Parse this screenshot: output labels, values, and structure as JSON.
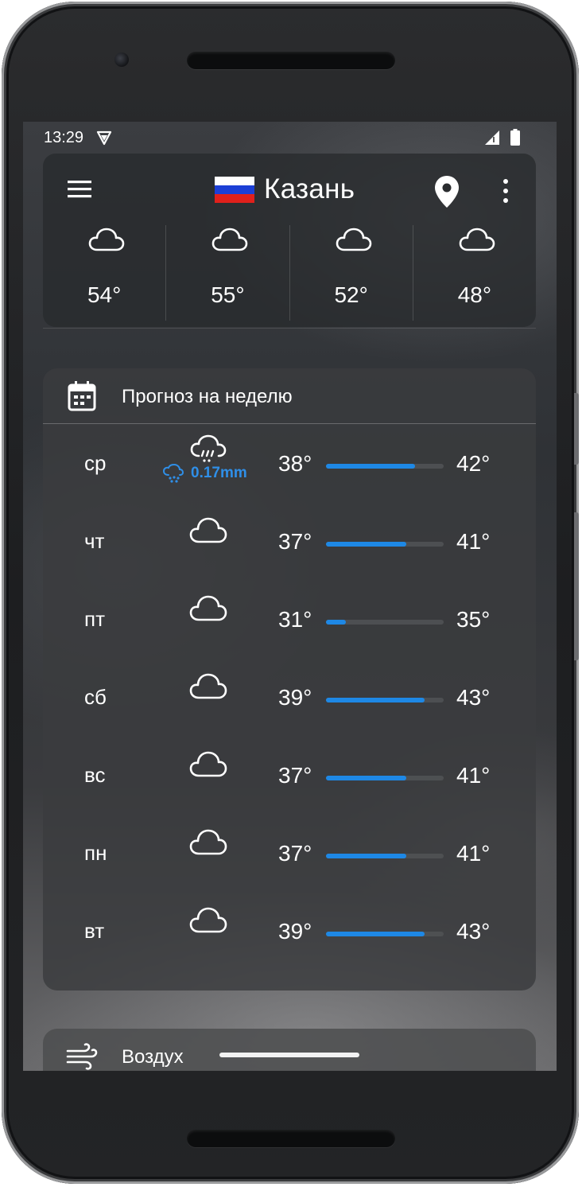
{
  "status_bar": {
    "time": "13:29",
    "icons": [
      "vpn-icon",
      "signal-icon",
      "battery-icon"
    ]
  },
  "header": {
    "city": "Казань",
    "flag": "russia-flag",
    "flag_colors": [
      "#ffffff",
      "#1c3fd6",
      "#e0201b"
    ],
    "menu_icon": "hamburger-menu-icon",
    "location_icon": "location-pin-icon",
    "more_icon": "more-vertical-icon"
  },
  "hourly": [
    {
      "icon": "cloud-icon",
      "temp": "54°"
    },
    {
      "icon": "cloud-icon",
      "temp": "55°"
    },
    {
      "icon": "cloud-icon",
      "temp": "52°"
    },
    {
      "icon": "cloud-icon",
      "temp": "48°"
    }
  ],
  "weekly": {
    "title": "Прогноз на неделю",
    "icon": "calendar-icon",
    "accent": "#1e88e5",
    "days": [
      {
        "day": "ср",
        "icon": "rain-cloud-icon",
        "precip": "0.17mm",
        "min": "38°",
        "max": "42°",
        "bar": 0.76
      },
      {
        "day": "чт",
        "icon": "cloud-icon",
        "min": "37°",
        "max": "41°",
        "bar": 0.68
      },
      {
        "day": "пт",
        "icon": "cloud-icon",
        "min": "31°",
        "max": "35°",
        "bar": 0.17
      },
      {
        "day": "сб",
        "icon": "cloud-icon",
        "min": "39°",
        "max": "43°",
        "bar": 0.84
      },
      {
        "day": "вс",
        "icon": "cloud-icon",
        "min": "37°",
        "max": "41°",
        "bar": 0.68
      },
      {
        "day": "пн",
        "icon": "cloud-icon",
        "min": "37°",
        "max": "41°",
        "bar": 0.68
      },
      {
        "day": "вт",
        "icon": "cloud-icon",
        "min": "39°",
        "max": "43°",
        "bar": 0.84
      }
    ]
  },
  "air": {
    "title": "Воздух",
    "icon": "wind-icon"
  }
}
